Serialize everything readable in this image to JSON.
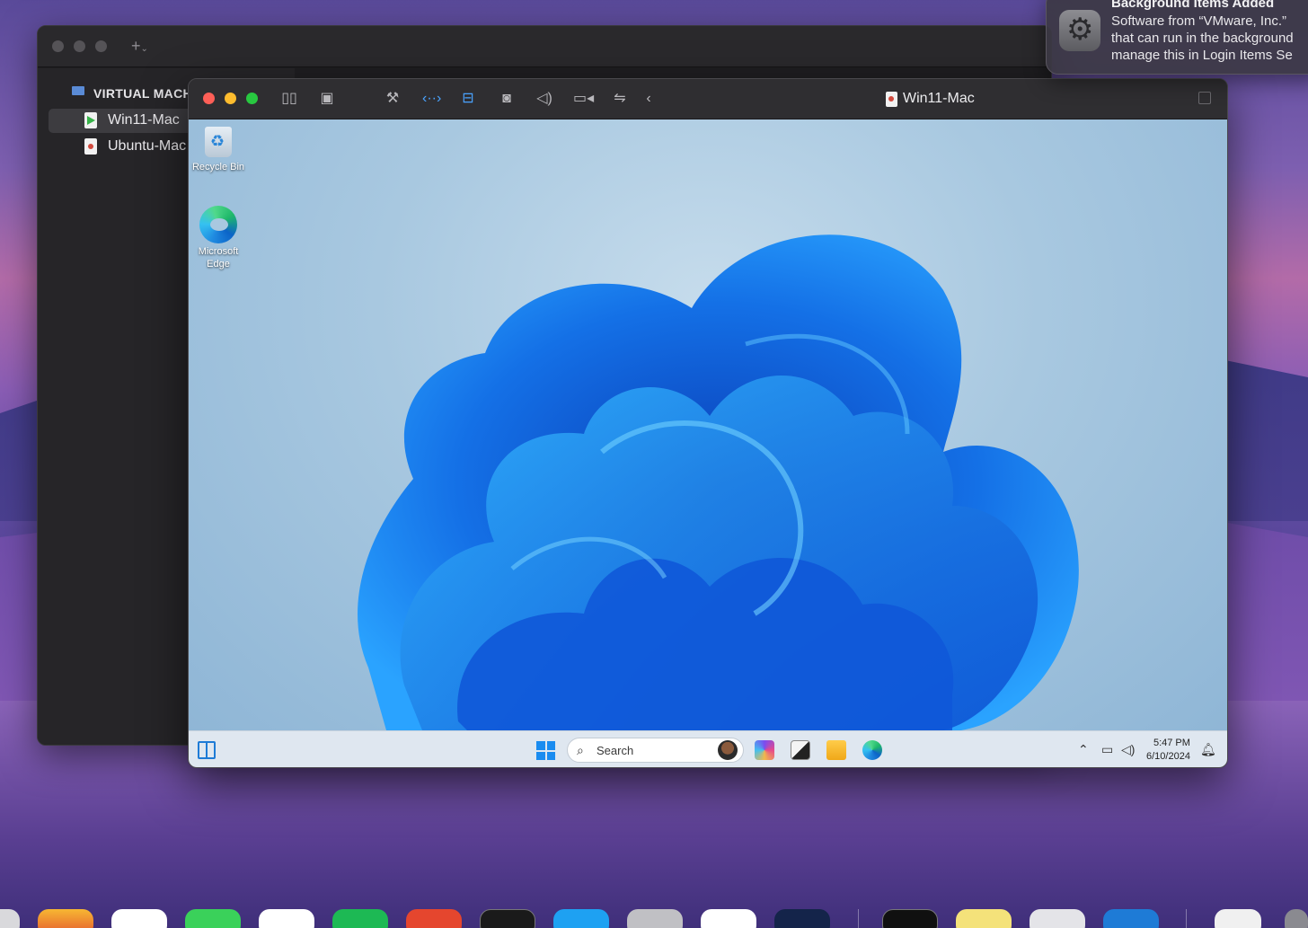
{
  "library": {
    "section_title": "VIRTUAL MACH",
    "add_label": "+",
    "items": [
      {
        "label": "Win11-Mac",
        "status": "running"
      },
      {
        "label": "Ubuntu-Mac",
        "status": "stopped"
      }
    ]
  },
  "vm_window": {
    "title": "Win11-Mac",
    "toolbar_icons": [
      "pause-icon",
      "snapshot-icon",
      "settings-wrench-icon",
      "network-icon",
      "disk-icon",
      "user-icon",
      "sound-icon",
      "camera-icon",
      "usb-icon",
      "back-chevron-icon"
    ]
  },
  "desktop": {
    "icons": [
      {
        "label": "Recycle Bin"
      },
      {
        "label": "Microsoft Edge"
      }
    ]
  },
  "taskbar": {
    "search_placeholder": "Search",
    "time": "5:47 PM",
    "date": "6/10/2024"
  },
  "notification": {
    "title": "Background Items Added",
    "lines": [
      "Software from “VMware, Inc.”",
      "that can run in the background",
      "manage this in Login Items Se"
    ]
  },
  "colors": {
    "accent": "#4aa3ff",
    "close": "#fe5f57",
    "minimize": "#febc2e",
    "zoom": "#28c840",
    "windows_blue": "#1a8cf0"
  }
}
